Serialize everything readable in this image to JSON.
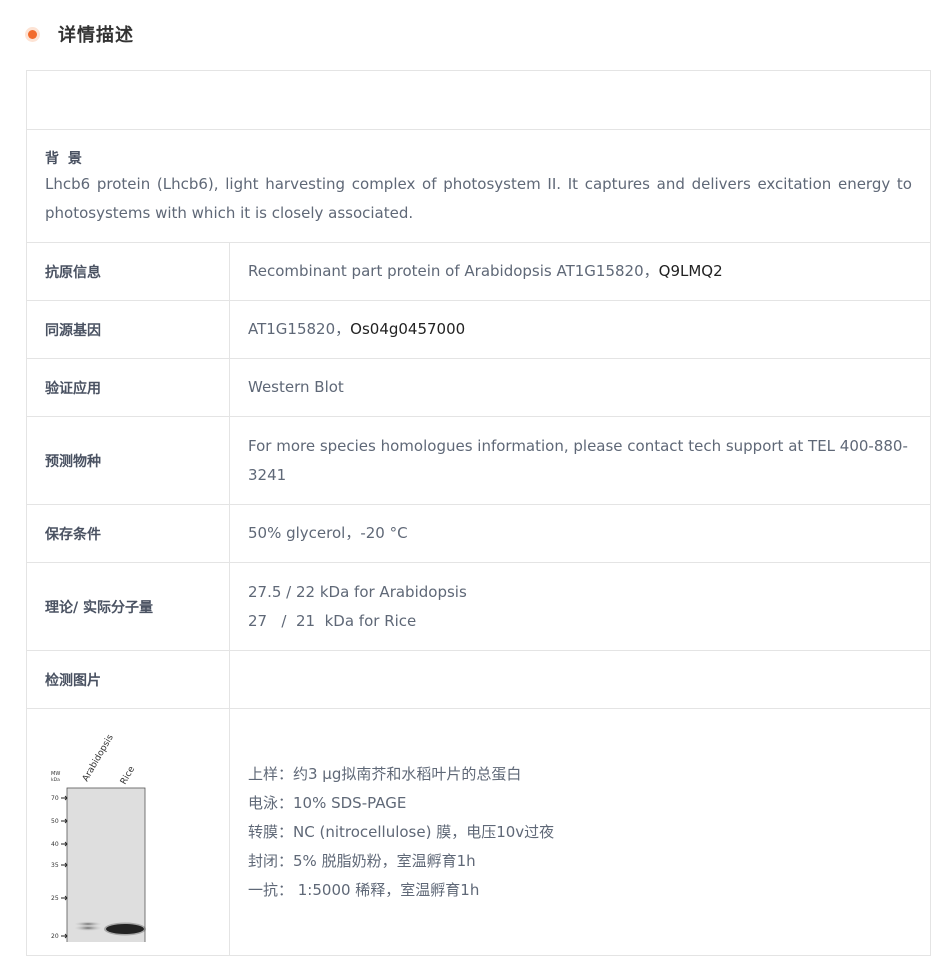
{
  "section": {
    "title": "详情描述"
  },
  "background": {
    "label": "背 景",
    "text": "Lhcb6 protein (Lhcb6), light harvesting complex of photosystem II. It captures and delivers excitation energy to photosystems with which it is closely associated."
  },
  "rows": {
    "antigen": {
      "label": "抗原信息",
      "value": "Recombinant part protein of Arabidopsis AT1G15820，",
      "value_link": "Q9LMQ2"
    },
    "homolog": {
      "label": "同源基因",
      "value": "AT1G15820，",
      "value_link": "Os04g0457000"
    },
    "application": {
      "label": "验证应用",
      "value": "Western Blot"
    },
    "species": {
      "label": "预测物种",
      "value": "For more species homologues information, please contact tech support at TEL 400-880-3241"
    },
    "storage": {
      "label": "保存条件",
      "value": "50% glycerol，-20 °C"
    },
    "mw": {
      "label": "理论/ 实际分子量",
      "line1": "27.5 / 22 kDa for Arabidopsis",
      "line2": "27   /  21  kDa for Rice"
    },
    "image": {
      "label": "检测图片"
    }
  },
  "blot": {
    "mw_header": "MW",
    "mw_unit": "kDa",
    "markers": [
      "70",
      "50",
      "40",
      "35",
      "25",
      "20"
    ],
    "lanes": [
      "Arabidopsis",
      "Rice"
    ]
  },
  "notes": [
    "上样：约3 µg拟南芥和水稻叶片的总蛋白",
    "电泳：10% SDS-PAGE",
    "转膜：NC (nitrocellulose) 膜，电压10v过夜",
    "封闭：5% 脱脂奶粉，室温孵育1h",
    "一抗： 1:5000 稀释，室温孵育1h"
  ]
}
